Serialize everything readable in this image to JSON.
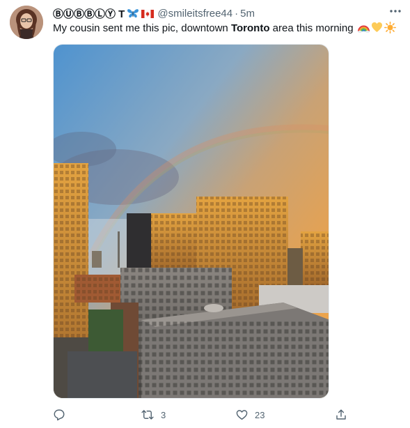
{
  "tweet": {
    "display_name": "ⒷⓊⒷⒷⓁⓎ T",
    "handle": "@smileitsfree44",
    "separator": "·",
    "time": "5m",
    "text_before": "My cousin sent me this pic, downtown ",
    "text_bold": "Toronto",
    "text_after": " area this morning",
    "emojis": [
      "rainbow-emoji",
      "yellow-heart-emoji",
      "sun-emoji"
    ],
    "photo_subject": "downtown-toronto-rainbow-photo"
  },
  "actions": {
    "retweet_count": "3",
    "like_count": "23",
    "reply_count": "",
    "icons": [
      "reply-icon",
      "retweet-icon",
      "like-icon",
      "share-icon"
    ]
  },
  "colors": {
    "text": "#0f1419",
    "secondary": "#536471",
    "flag_red": "#d52b1e"
  }
}
